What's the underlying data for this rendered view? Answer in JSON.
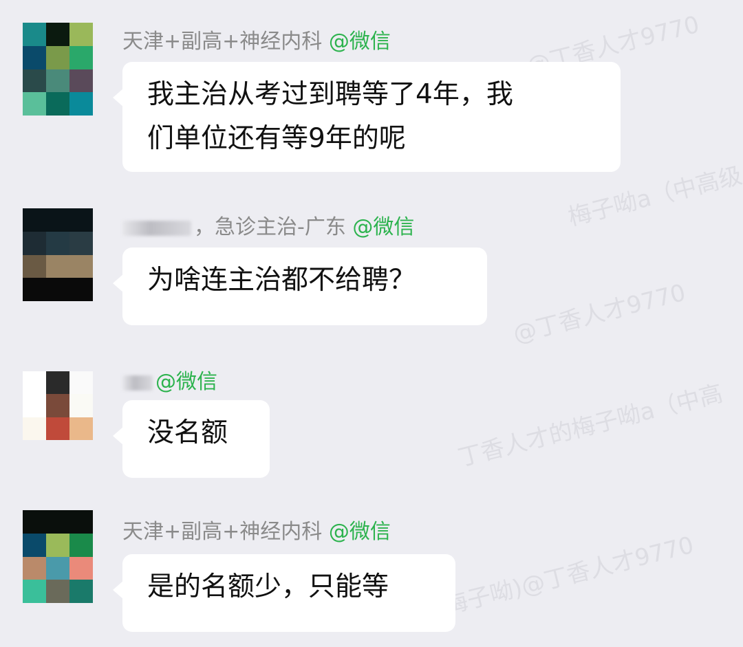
{
  "messages": [
    {
      "sender": "天津+副高+神经内科",
      "tag": "@微信",
      "text": "我主治从考过到聘等了4年，我们单位还有等9年的呢",
      "line1": "我主治从考过到聘等了4年，我",
      "line2": "们单位还有等9年的呢",
      "avatar_colors": [
        "#1a8a8a",
        "#0b1a0f",
        "#9ab85a",
        "#0a4a6a",
        "#7a9a4a",
        "#2aa86a",
        "#2a4a4a",
        "#4a8a7a",
        "#5a4a5a",
        "#5abf9a",
        "#0a6a5a",
        "#0a8a9a"
      ]
    },
    {
      "sender": "，急诊主治-广东",
      "tag": "@微信",
      "text": "为啥连主治都不给聘？",
      "avatar_colors": [
        "#0a1418",
        "#0a1418",
        "#0a1418",
        "#1e2c34",
        "#243a44",
        "#2a3c44",
        "#6a5a44",
        "#9a8464",
        "#9a8464",
        "#0a0a0a",
        "#0a0a0a",
        "#0a0a0a"
      ]
    },
    {
      "sender": "",
      "tag": "@微信",
      "text": "没名额",
      "avatar_colors": [
        "#ffffff",
        "#2a2a2a",
        "#fafafa",
        "#ffffff",
        "#7a4a3a",
        "#fafaf5",
        "#fbf7ee",
        "#c04a3a",
        "#eab88a",
        "#ededf2",
        "#ededf2",
        "#ededf2"
      ]
    },
    {
      "sender": "天津+副高+神经内科",
      "tag": "@微信",
      "text": "是的名额少，只能等",
      "avatar_colors": [
        "#0a0f0c",
        "#0a0f0c",
        "#0a0f0c",
        "#0a4a6a",
        "#9aba5a",
        "#1a8a4a",
        "#ba8a6a",
        "#4a9aaa",
        "#ea8a7a",
        "#3abf9a",
        "#6a6a5a",
        "#1a7a6a"
      ]
    }
  ],
  "watermarks": [
    "@丁香人才9770",
    "梅子呦a（中高级",
    "丁香人才的梅子呦a（中高",
    "梅子呦)@丁香人才9770"
  ]
}
